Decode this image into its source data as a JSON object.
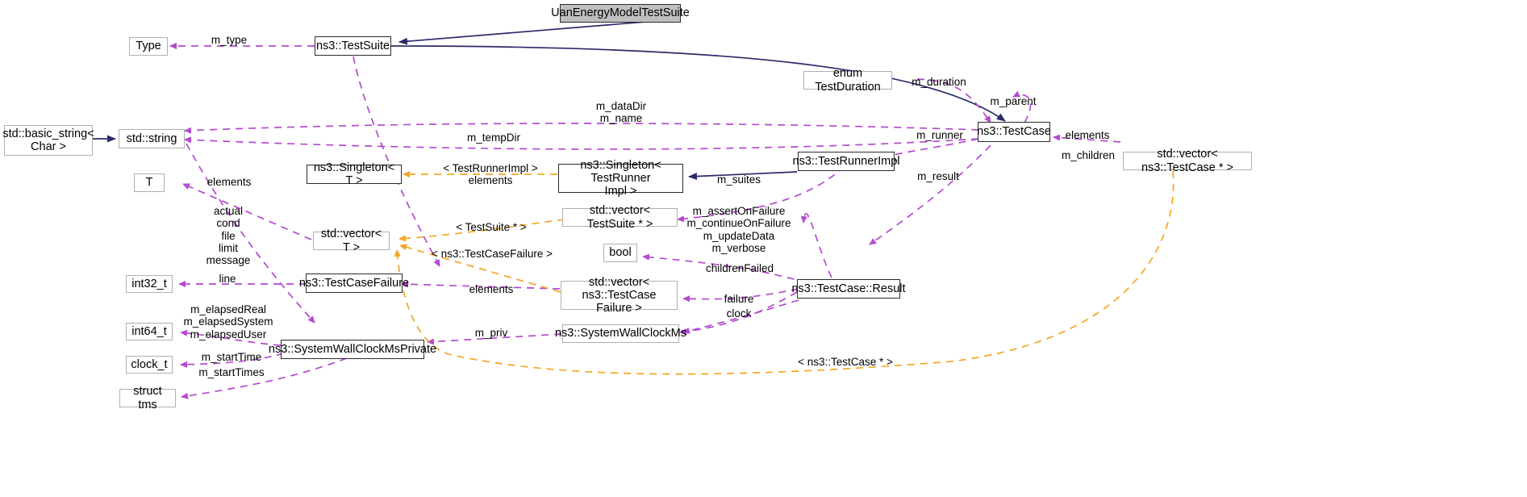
{
  "diagram": {
    "title": "UanEnergyModelTestSuite collaboration diagram",
    "type": "uml-collaboration",
    "colors": {
      "inheritance_edge": "#2a2a6a",
      "usage_edge": "#b44ad0",
      "template_edge": "#f5a623",
      "node_border": "#2b2b2b",
      "node_border_light": "#b0b0b0",
      "highlight_fill": "#bfbfbf",
      "background": "#ffffff"
    }
  },
  "nodes": [
    {
      "id": "uan",
      "label": "UanEnergyModelTestSuite",
      "style": "current"
    },
    {
      "id": "type",
      "label": "Type",
      "style": "plain"
    },
    {
      "id": "testsuite",
      "label": "ns3::TestSuite",
      "style": "strong"
    },
    {
      "id": "basicstring",
      "label": "std::basic_string<\nChar >",
      "style": "plain"
    },
    {
      "id": "stdstring",
      "label": "std::string",
      "style": "plain"
    },
    {
      "id": "tparam",
      "label": "T",
      "style": "plain"
    },
    {
      "id": "singleton_t",
      "label": "ns3::Singleton< T >",
      "style": "strong"
    },
    {
      "id": "singleton_tri",
      "label": "ns3::Singleton< TestRunner\nImpl >",
      "style": "strong"
    },
    {
      "id": "enumduration",
      "label": "enum TestDuration",
      "style": "plain"
    },
    {
      "id": "testcase",
      "label": "ns3::TestCase",
      "style": "strong"
    },
    {
      "id": "vec_testcaseptr",
      "label": "std::vector< ns3::TestCase * >",
      "style": "plain"
    },
    {
      "id": "testrunnerimpl",
      "label": "ns3::TestRunnerImpl",
      "style": "strong"
    },
    {
      "id": "vec_testsuite",
      "label": "std::vector< TestSuite * >",
      "style": "plain"
    },
    {
      "id": "vec_t",
      "label": "std::vector< T >",
      "style": "plain"
    },
    {
      "id": "boolnode",
      "label": "bool",
      "style": "plain"
    },
    {
      "id": "int32",
      "label": "int32_t",
      "style": "plain"
    },
    {
      "id": "testcasefailure",
      "label": "ns3::TestCaseFailure",
      "style": "strong"
    },
    {
      "id": "vec_tcfailure",
      "label": "std::vector< ns3::TestCase\nFailure >",
      "style": "plain"
    },
    {
      "id": "result",
      "label": "ns3::TestCase::Result",
      "style": "strong"
    },
    {
      "id": "int64",
      "label": "int64_t",
      "style": "plain"
    },
    {
      "id": "wallclockpriv",
      "label": "ns3::SystemWallClockMsPrivate",
      "style": "strong"
    },
    {
      "id": "wallclockms",
      "label": "ns3::SystemWallClockMs",
      "style": "plain"
    },
    {
      "id": "clockt",
      "label": "clock_t",
      "style": "plain"
    },
    {
      "id": "structtms",
      "label": "struct tms",
      "style": "plain"
    }
  ],
  "edge_labels": [
    {
      "id": "l_mtype",
      "text": "m_type"
    },
    {
      "id": "l_datadir",
      "text": "m_dataDir\nm_name"
    },
    {
      "id": "l_tempdir",
      "text": "m_tempDir"
    },
    {
      "id": "l_duration",
      "text": "m_duration"
    },
    {
      "id": "l_parent",
      "text": "m_parent"
    },
    {
      "id": "l_runner",
      "text": "m_runner"
    },
    {
      "id": "l_elements_tc",
      "text": "elements"
    },
    {
      "id": "l_children",
      "text": "m_children"
    },
    {
      "id": "l_suites",
      "text": "m_suites"
    },
    {
      "id": "l_result",
      "text": "m_result"
    },
    {
      "id": "l_tri_tmpl",
      "text": "< TestRunnerImpl >\nelements"
    },
    {
      "id": "l_elements_t",
      "text": "elements"
    },
    {
      "id": "l_fields",
      "text": "actual\ncond\nfile\nlimit\nmessage"
    },
    {
      "id": "l_testsuiteptr",
      "text": "< TestSuite * >"
    },
    {
      "id": "l_tcfailure_t",
      "text": "< ns3::TestCaseFailure >"
    },
    {
      "id": "l_flags",
      "text": "m_assertOnFailure\nm_continueOnFailure\nm_updateData\nm_verbose"
    },
    {
      "id": "l_childrenfailed",
      "text": "childrenFailed"
    },
    {
      "id": "l_line",
      "text": "line"
    },
    {
      "id": "l_elements_fail",
      "text": "elements"
    },
    {
      "id": "l_failure",
      "text": "failure"
    },
    {
      "id": "l_clock",
      "text": "clock"
    },
    {
      "id": "l_elapsed",
      "text": "m_elapsedReal\nm_elapsedSystem\nm_elapsedUser"
    },
    {
      "id": "l_priv",
      "text": "m_priv"
    },
    {
      "id": "l_starttime",
      "text": "m_startTime"
    },
    {
      "id": "l_starttimes",
      "text": "m_startTimes"
    },
    {
      "id": "l_tcptr_tmpl",
      "text": "< ns3::TestCase * >"
    }
  ]
}
